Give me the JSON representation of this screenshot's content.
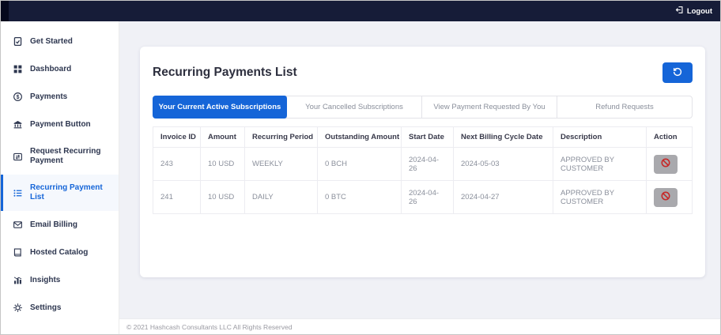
{
  "colors": {
    "accent": "#1565d8",
    "navbar": "#161c38",
    "action-red": "#c62828"
  },
  "topbar": {
    "logout_label": "Logout",
    "logout_icon": "logout-icon"
  },
  "sidebar": {
    "items": [
      {
        "label": "Get Started",
        "icon": "clipboard-check-icon",
        "active": false
      },
      {
        "label": "Dashboard",
        "icon": "grid-icon",
        "active": false
      },
      {
        "label": "Payments",
        "icon": "dollar-circle-icon",
        "active": false
      },
      {
        "label": "Payment Button",
        "icon": "bank-icon",
        "active": false
      },
      {
        "label": "Request Recurring Payment",
        "icon": "transfer-card-icon",
        "active": false
      },
      {
        "label": "Recurring Payment List",
        "icon": "list-icon",
        "active": true
      },
      {
        "label": "Email Billing",
        "icon": "envelope-icon",
        "active": false
      },
      {
        "label": "Hosted Catalog",
        "icon": "book-icon",
        "active": false
      },
      {
        "label": "Insights",
        "icon": "bar-chart-icon",
        "active": false
      },
      {
        "label": "Settings",
        "icon": "gear-icon",
        "active": false
      }
    ]
  },
  "main": {
    "title": "Recurring Payments List",
    "history_button_icon": "history-icon",
    "tabs": [
      "Your Current Active Subscriptions",
      "Your Cancelled Subscriptions",
      "View Payment Requested By You",
      "Refund Requests"
    ],
    "active_tab": "Your Current Active Subscriptions",
    "table": {
      "headers": [
        "Invoice ID",
        "Amount",
        "Recurring Period",
        "Outstanding Amount",
        "Start Date",
        "Next Billing Cycle Date",
        "Description",
        "Action"
      ],
      "action_icon": "block-icon",
      "rows": [
        [
          "243",
          "10 USD",
          "WEEKLY",
          "0 BCH",
          "2024-04-26",
          "2024-05-03",
          "APPROVED BY CUSTOMER"
        ],
        [
          "241",
          "10 USD",
          "DAILY",
          "0 BTC",
          "2024-04-26",
          "2024-04-27",
          "APPROVED BY CUSTOMER"
        ]
      ]
    }
  },
  "footer": {
    "copyright": "© 2021 Hashcash Consultants LLC All Rights Reserved"
  }
}
